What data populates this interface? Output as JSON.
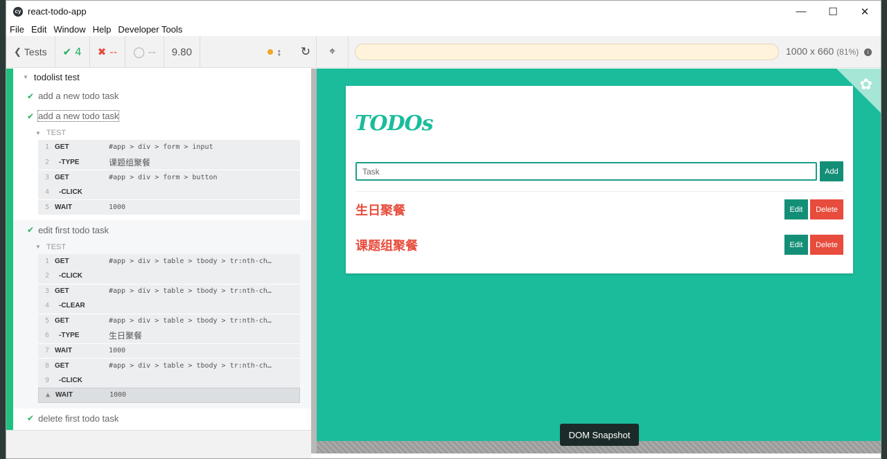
{
  "window": {
    "title": "react-todo-app",
    "app_icon": "cy",
    "controls": {
      "minimize": "—",
      "maximize": "☐",
      "close": "✕"
    }
  },
  "menu": [
    "File",
    "Edit",
    "Window",
    "Help",
    "Developer Tools"
  ],
  "toolbar": {
    "tests_label": "Tests",
    "passed": "4",
    "failed": "--",
    "pending": "--",
    "duration": "9.80",
    "viewport_size": "1000 x 660",
    "viewport_scale": "(81%)",
    "info_glyph": "i"
  },
  "reporter": {
    "suite_title": "todolist test",
    "tests": [
      {
        "title": "add a new todo task"
      },
      {
        "title": "add a new todo task",
        "section": "TEST",
        "commands": [
          {
            "n": "1",
            "name": "GET",
            "msg": "#app > div > form > input"
          },
          {
            "n": "2",
            "name": "-TYPE",
            "msg": "课题组聚餐"
          },
          {
            "n": "3",
            "name": "GET",
            "msg": "#app > div > form > button"
          },
          {
            "n": "4",
            "name": "-CLICK",
            "msg": ""
          },
          {
            "n": "5",
            "name": "WAIT",
            "msg": "1000"
          }
        ]
      },
      {
        "title": "edit first todo task",
        "section": "TEST",
        "commands": [
          {
            "n": "1",
            "name": "GET",
            "msg": "#app > div > table > tbody > tr:nth-ch…"
          },
          {
            "n": "2",
            "name": "-CLICK",
            "msg": ""
          },
          {
            "n": "3",
            "name": "GET",
            "msg": "#app > div > table > tbody > tr:nth-ch…"
          },
          {
            "n": "4",
            "name": "-CLEAR",
            "msg": ""
          },
          {
            "n": "5",
            "name": "GET",
            "msg": "#app > div > table > tbody > tr:nth-ch…"
          },
          {
            "n": "6",
            "name": "-TYPE",
            "msg": "生日聚餐"
          },
          {
            "n": "7",
            "name": "WAIT",
            "msg": "1000"
          },
          {
            "n": "8",
            "name": "GET",
            "msg": "#app > div > table > tbody > tr:nth-ch…"
          },
          {
            "n": "9",
            "name": "-CLICK",
            "msg": ""
          },
          {
            "n": "",
            "name": "WAIT",
            "msg": "1000"
          }
        ]
      },
      {
        "title": "delete first todo task"
      }
    ]
  },
  "app": {
    "heading": "TODOs",
    "input_placeholder": "Task",
    "add_label": "Add",
    "todos": [
      {
        "text": "生日聚餐",
        "edit": "Edit",
        "delete": "Delete"
      },
      {
        "text": "课题组聚餐",
        "edit": "Edit",
        "delete": "Delete"
      }
    ]
  },
  "snapshot_label": "DOM Snapshot",
  "colors": {
    "accent": "#1abc9c",
    "pass": "#27ae60",
    "danger": "#e74c3c",
    "button": "#148f77"
  }
}
